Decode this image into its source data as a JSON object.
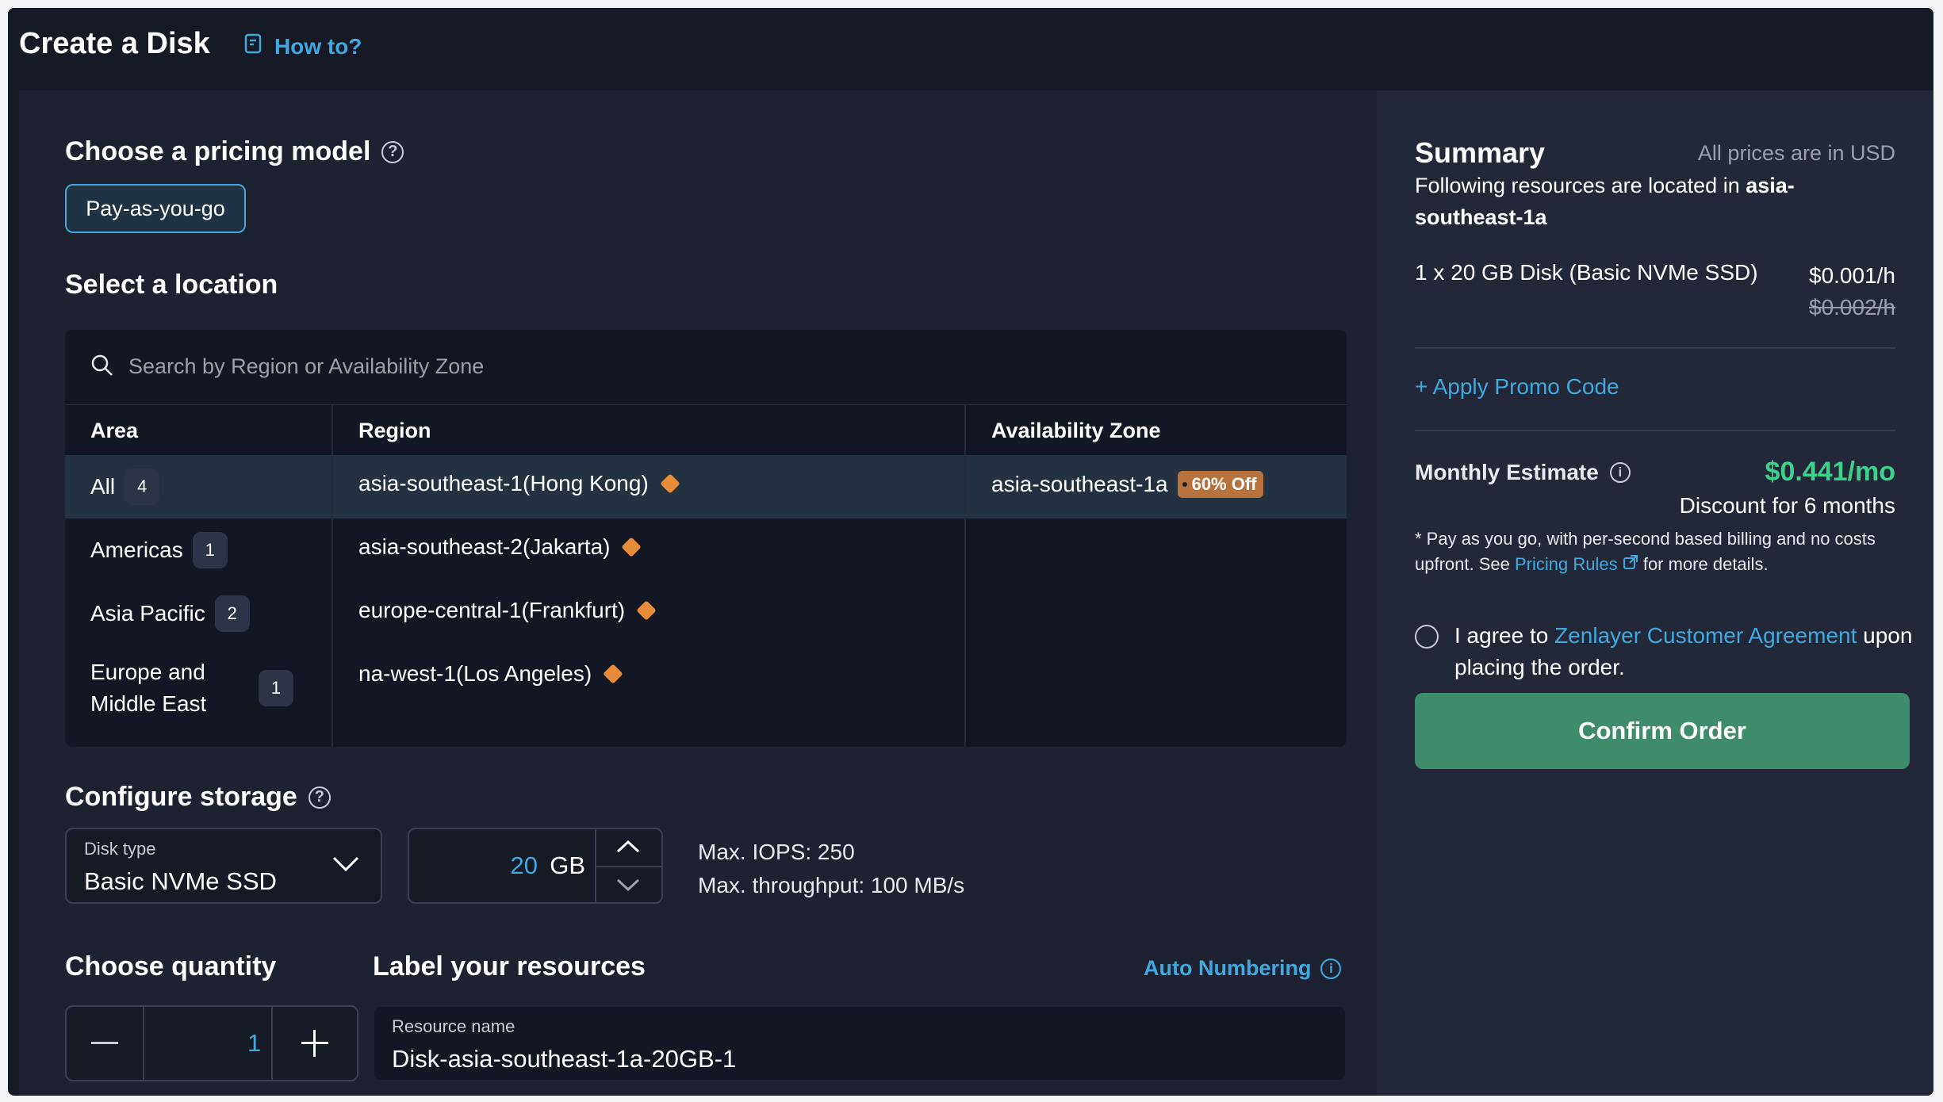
{
  "page": {
    "title": "Create a Disk",
    "how_to": "How to?"
  },
  "pricing": {
    "heading": "Choose a pricing model",
    "selected": "Pay-as-you-go"
  },
  "location": {
    "heading": "Select a location",
    "search_placeholder": "Search by Region or Availability Zone",
    "columns": {
      "area": "Area",
      "region": "Region",
      "zone": "Availability Zone"
    },
    "areas": [
      {
        "label": "All",
        "count": "4"
      },
      {
        "label": "Americas",
        "count": "1"
      },
      {
        "label": "Asia Pacific",
        "count": "2"
      },
      {
        "label": "Europe and Middle East",
        "count": "1"
      }
    ],
    "regions": [
      "asia-southeast-1(Hong Kong)",
      "asia-southeast-2(Jakarta)",
      "europe-central-1(Frankfurt)",
      "na-west-1(Los Angeles)"
    ],
    "zones": [
      {
        "label": "asia-southeast-1a",
        "discount": "60% Off"
      }
    ]
  },
  "storage": {
    "heading": "Configure storage",
    "disk_type_label": "Disk type",
    "disk_type": "Basic NVMe SSD",
    "size": "20",
    "unit": "GB",
    "max_iops": "Max. IOPS: 250",
    "max_throughput": "Max. throughput: 100 MB/s"
  },
  "quantity": {
    "heading": "Choose quantity",
    "value": "1"
  },
  "label": {
    "heading": "Label your resources",
    "auto_numbering": "Auto Numbering",
    "resource_name_label": "Resource name",
    "resource_name": "Disk-asia-southeast-1a-20GB-1"
  },
  "summary": {
    "title": "Summary",
    "currency_note": "All prices are in USD",
    "location_prefix": "Following resources are located in ",
    "location": "asia-southeast-1a",
    "item": "1 x 20 GB Disk (Basic NVMe SSD)",
    "price": "$0.001/h",
    "original_price": "$0.002/h",
    "promo": "+ Apply Promo Code",
    "estimate_label": "Monthly Estimate",
    "estimate_value": "$0.441/mo",
    "estimate_discount": "Discount for 6 months",
    "footnote_1": "* Pay as you go, with per-second based billing and no costs upfront. See ",
    "footnote_link": "Pricing Rules",
    "footnote_2": " for more details.",
    "agree_1": "I agree to ",
    "agree_link": "Zenlayer Customer Agreement",
    "agree_2": " upon placing the order.",
    "confirm": "Confirm Order"
  },
  "colors": {
    "accent": "#3fa9e0",
    "success": "#3dd28c",
    "confirm": "#3e8c6c",
    "tag": "#e88b3a"
  }
}
